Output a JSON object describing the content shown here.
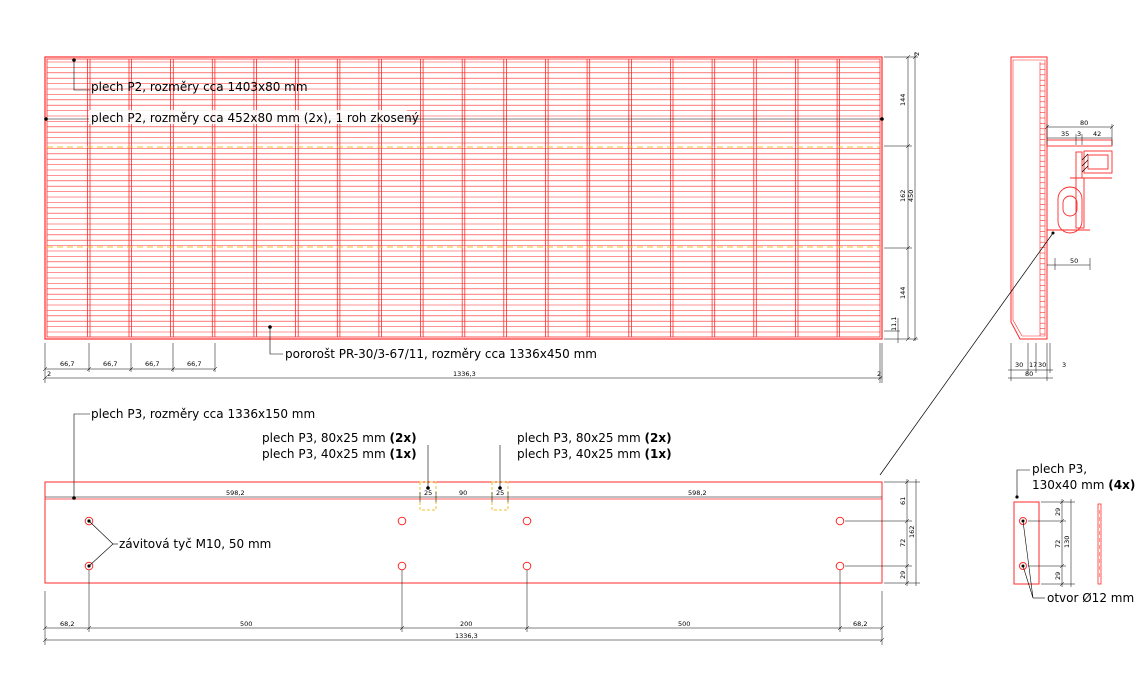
{
  "colors": {
    "steel": "#ff2a2a",
    "hidden": "#f5c12a",
    "dimension": "#000000"
  },
  "grating_view": {
    "labels": {
      "p2_long": "plech P2, rozměry cca 1403x80 mm",
      "p2_short": "plech P2, rozměry cca 452x80 mm (2x), 1 roh zkosený",
      "grating": "pororošt PR-30/3-67/11, rozměry cca 1336x450 mm"
    },
    "dims_bottom": [
      "66,7",
      "66,7",
      "66,7",
      "66,7"
    ],
    "dim_total": "1336,3",
    "dim_left_small": "2",
    "dim_right_small": "2",
    "dims_right": [
      "144",
      "162",
      "144"
    ],
    "dim_right_total": "450",
    "dim_top_small": "2",
    "dim_bottom_small": "11,1"
  },
  "section_view": {
    "dims_top": [
      "80",
      "35",
      "3",
      "42"
    ],
    "dim_side": "50",
    "dims_bottom": [
      "30",
      "17",
      "30",
      "3"
    ],
    "dim_bottom_total": "80"
  },
  "plate_view": {
    "labels": {
      "p3_long": "plech P3, rozměry cca 1336x150 mm",
      "p3_small_left_1": "plech P3, 80x25 mm ",
      "p3_small_left_1_qty": "(2x)",
      "p3_small_left_2": "plech P3, 40x25 mm ",
      "p3_small_left_2_qty": "(1x)",
      "p3_small_right_1": "plech P3, 80x25 mm ",
      "p3_small_right_1_qty": "(2x)",
      "p3_small_right_2": "plech P3, 40x25 mm ",
      "p3_small_right_2_qty": "(1x)",
      "threaded_rod": "závitová tyč M10, 50 mm"
    },
    "dims_top": [
      "598,2",
      "25",
      "90",
      "25",
      "598,2"
    ],
    "dims_right": [
      "61",
      "162",
      "72",
      "29"
    ],
    "dims_bottom": [
      "68,2",
      "500",
      "200",
      "500",
      "68,2"
    ],
    "dim_total": "1336,3"
  },
  "small_plate_view": {
    "labels": {
      "title_1": "plech P3,",
      "title_2": "130x40 mm ",
      "title_qty": "(4x)",
      "hole": "otvor Ø12 mm"
    },
    "dims": [
      "29",
      "72",
      "29"
    ],
    "dim_total": "130"
  }
}
